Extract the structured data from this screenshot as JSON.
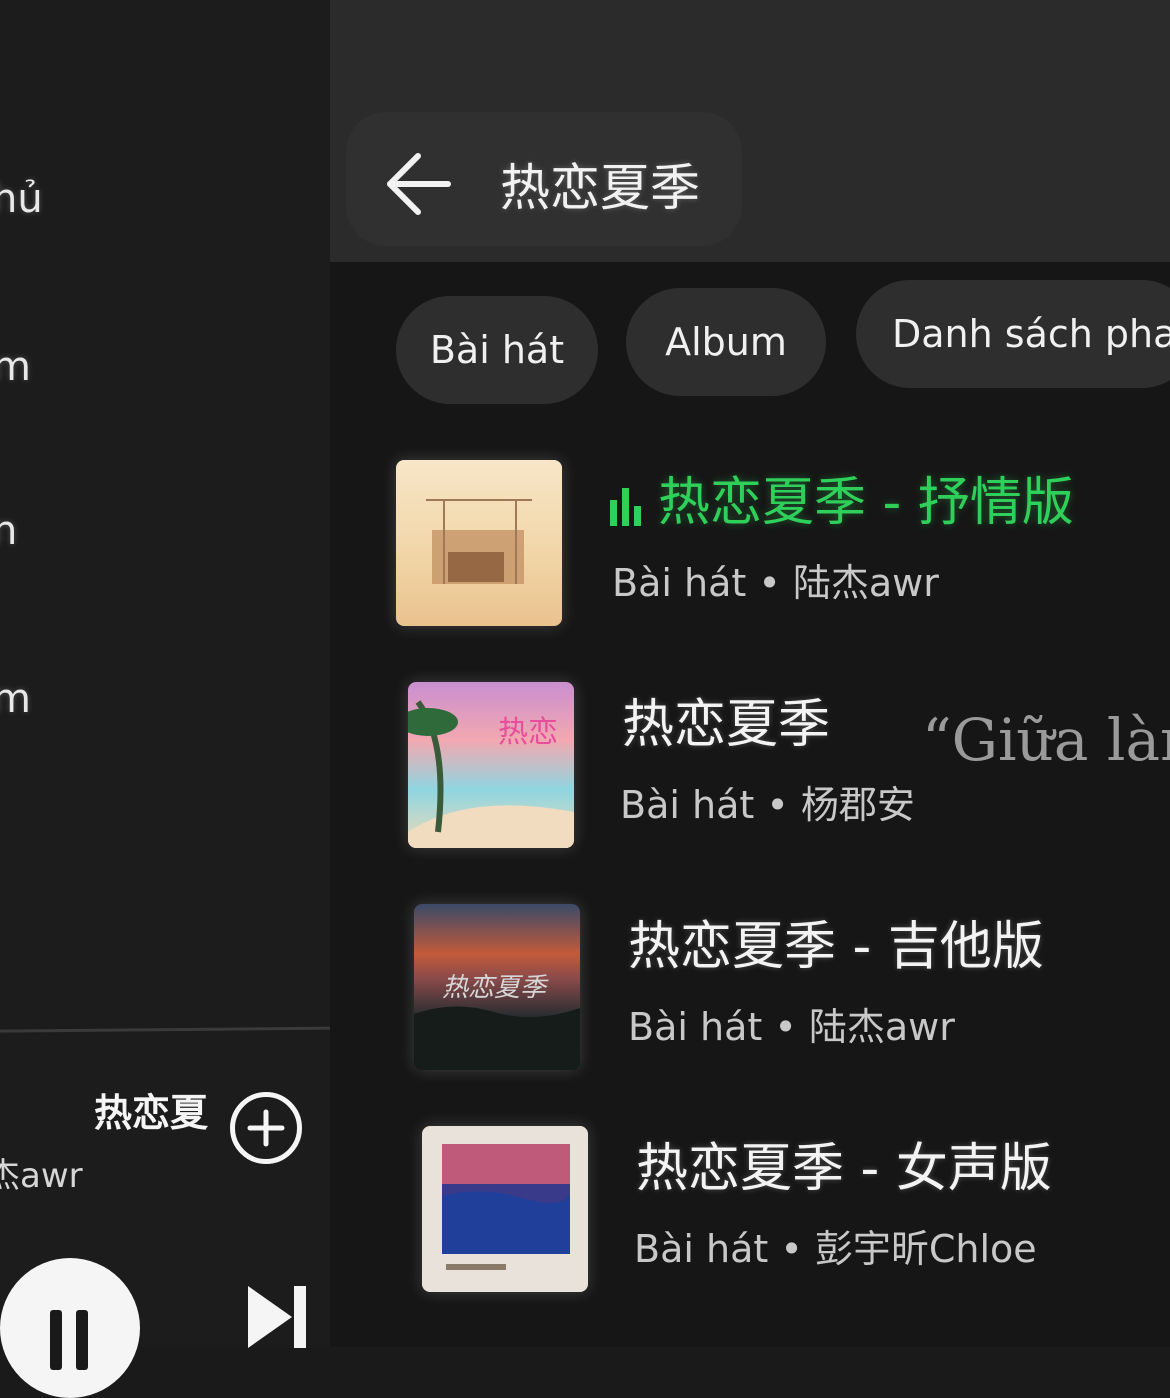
{
  "sidebar": {
    "items": [
      {
        "label": "hủ"
      },
      {
        "label": "m"
      },
      {
        "label": "n"
      },
      {
        "label": "m"
      }
    ]
  },
  "mini_player": {
    "title": "热恋夏",
    "artist": "杰awr",
    "add_icon": "plus-circle-icon",
    "pause_icon": "pause-icon",
    "next_icon": "skip-next-icon"
  },
  "header": {
    "back_icon": "arrow-left-icon",
    "title": "热恋夏季"
  },
  "filters": {
    "chips": [
      {
        "label": "Bài hát"
      },
      {
        "label": "Album"
      },
      {
        "label": "Danh sách pha"
      }
    ]
  },
  "results": [
    {
      "title": "热恋夏季 - 抒情版",
      "subtitle": "Bài hát • 陆杰awr",
      "playing": true
    },
    {
      "title": "热恋夏季",
      "subtitle": "Bài hát • 杨郡安",
      "playing": false
    },
    {
      "title": "热恋夏季 - 吉他版",
      "subtitle": "Bài hát • 陆杰awr",
      "playing": false
    },
    {
      "title": "热恋夏季 - 女声版",
      "subtitle": "Bài hát • 彭宇昕Chloe",
      "playing": false
    }
  ],
  "overlay_text": "“Giữa làn",
  "colors": {
    "accent_playing": "#2fd05a",
    "background": "#161616",
    "header": "#2b2b2b"
  }
}
